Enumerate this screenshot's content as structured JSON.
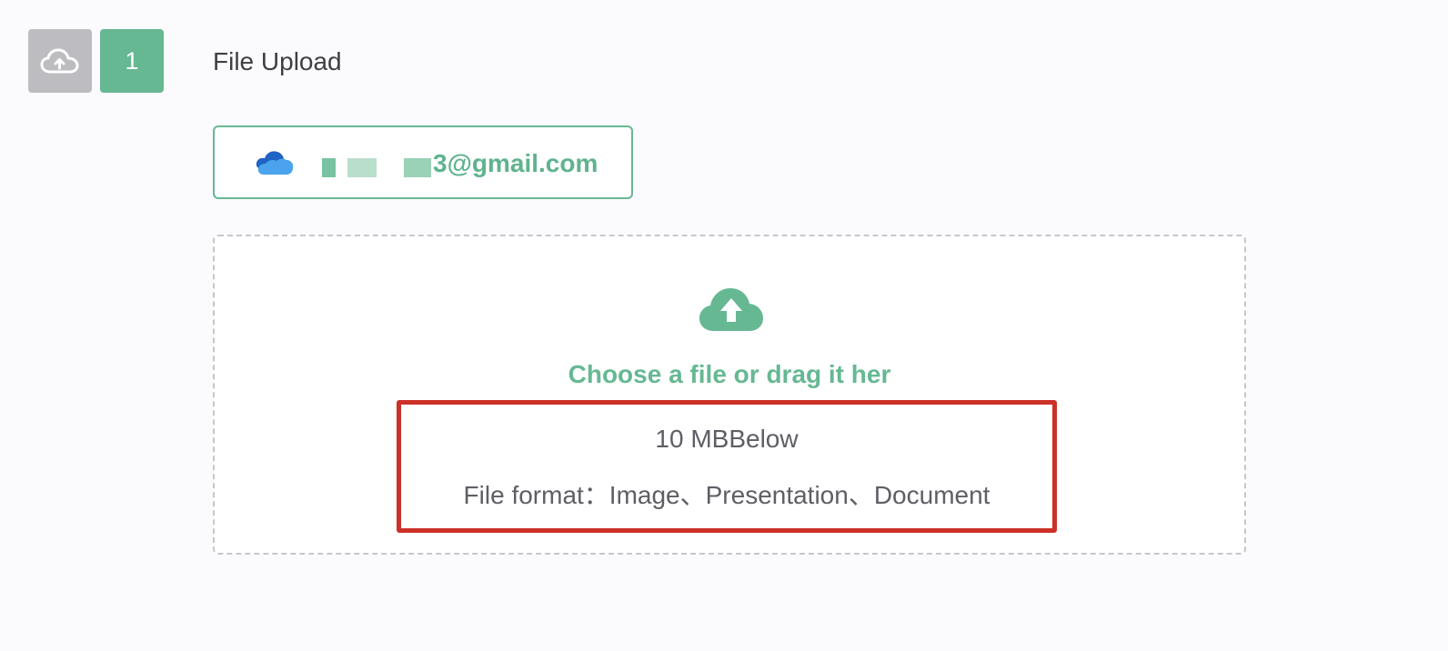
{
  "header": {
    "step_number": "1",
    "title": "File Upload",
    "cloud_tab_icon": "cloud-upload-outline-icon"
  },
  "account": {
    "provider_icon": "onedrive-icon",
    "email_visible": "@gmail.com",
    "email_prefix_partial": "3"
  },
  "dropzone": {
    "icon": "cloud-upload-icon",
    "prompt": "Choose a file or drag it her",
    "size_limit": "10 MBBelow",
    "formats": "File format：Image、Presentation、Document"
  },
  "colors": {
    "accent": "#66b893",
    "inactive_tab": "#bdbcc0",
    "highlight_border": "#cc3128",
    "text_primary": "#3f3f44",
    "text_secondary": "#5f5e65",
    "background": "#fbfafc"
  }
}
